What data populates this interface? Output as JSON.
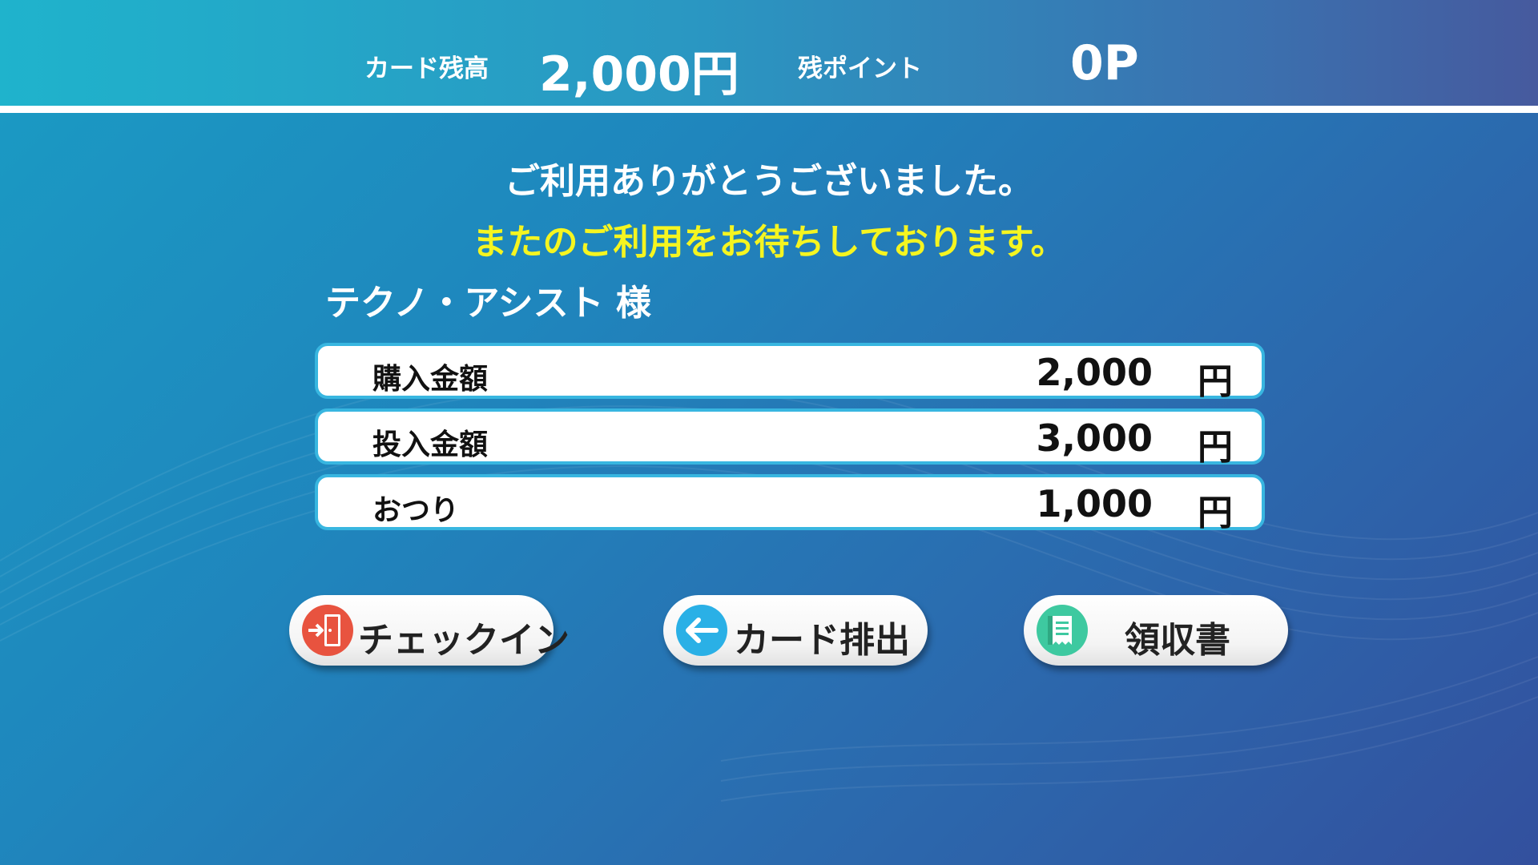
{
  "header": {
    "balance_label": "カード残高",
    "balance_value": "2,000円",
    "points_label": "残ポイント",
    "points_value": "0P"
  },
  "messages": {
    "thanks": "ご利用ありがとうございました。",
    "again": "またのご利用をお待ちしております。"
  },
  "customer": {
    "name": "テクノ・アシスト 様"
  },
  "rows": [
    {
      "label": "購入金額",
      "value": "2,000",
      "unit": "円"
    },
    {
      "label": "投入金額",
      "value": "3,000",
      "unit": "円"
    },
    {
      "label": "おつり",
      "value": "1,000",
      "unit": "円"
    }
  ],
  "buttons": {
    "checkin": {
      "label": "チェックイン",
      "icon": "door-exit-icon"
    },
    "eject": {
      "label": "カード排出",
      "icon": "arrow-left-icon"
    },
    "receipt": {
      "label": "領収書",
      "icon": "receipt-icon"
    }
  },
  "colors": {
    "accent_yellow": "#f5f520",
    "row_border": "#38b6e0",
    "checkin_icon": "#e8533f",
    "eject_icon": "#2ab0e6",
    "receipt_icon": "#3ec9a0"
  }
}
